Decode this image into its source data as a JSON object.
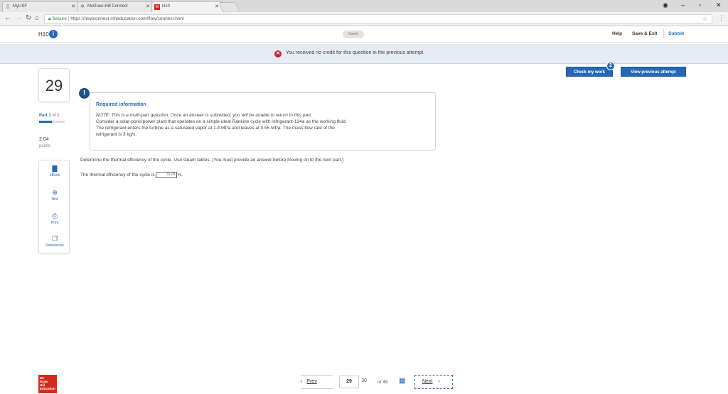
{
  "browser": {
    "tabs": [
      {
        "label": "MyUSF",
        "icon": "page-icon"
      },
      {
        "label": "McGraw-Hill Connect",
        "icon": "connect-icon"
      },
      {
        "label": "H10",
        "icon": "mcgraw-hill-icon"
      }
    ],
    "url_secure_label": "Secure",
    "url": "https://newconnect.mheducation.com/flow/connect.html"
  },
  "app": {
    "assignment_title": "H10",
    "saved_label": "Saved",
    "help_label": "Help",
    "save_exit_label": "Save & Exit",
    "submit_label": "Submit"
  },
  "banner": {
    "message": "You received no credit for this question in the previous attempt."
  },
  "actions": {
    "check_work_label": "Check my work",
    "check_work_badge": "2",
    "view_previous_label": "View previous attempt"
  },
  "question": {
    "number": "29",
    "part_label_prefix": "Part 1",
    "part_label_suffix": "of 2",
    "points_value": "2.04",
    "points_label": "points",
    "progress_fraction": 0.5
  },
  "tools": [
    {
      "label": "eBook",
      "icon": "book-icon"
    },
    {
      "label": "Hint",
      "icon": "hint-icon"
    },
    {
      "label": "Print",
      "icon": "print-icon"
    },
    {
      "label": "References",
      "icon": "references-icon"
    }
  ],
  "info": {
    "heading": "Required information",
    "note": "NOTE: This is a multi-part question. Once an answer is submitted, you will be unable to return to this part.",
    "line1": "Consider a solar-pond power plant that operates on a simple ideal Rankine cycle with refrigerant-134a as the working fluid.",
    "line2": "The refrigerant enters the turbine as a saturated vapor at 1.4 MPa and leaves at 0.55 MPa. The mass flow rate of the",
    "line3": "refrigerant is 3 kg/s."
  },
  "prompt": {
    "instruction": "Determine the thermal efficiency of the cycle. Use steam tables. (You must provide an answer before moving on to the next part.)",
    "answer_prefix": "The thermal efficiency of the cycle is",
    "answer_value": "32.08",
    "answer_suffix": "%."
  },
  "pagination": {
    "prev_label": "Prev",
    "current_page": "29",
    "next_page": "30",
    "of_total": "of 49",
    "next_label": "Next"
  },
  "logo": {
    "text": "Mc Graw Hill Education"
  },
  "colors": {
    "accent": "#2668b4",
    "banner_bg": "#e5ecf3",
    "error": "#c62828",
    "logo_red": "#d52b1e"
  }
}
